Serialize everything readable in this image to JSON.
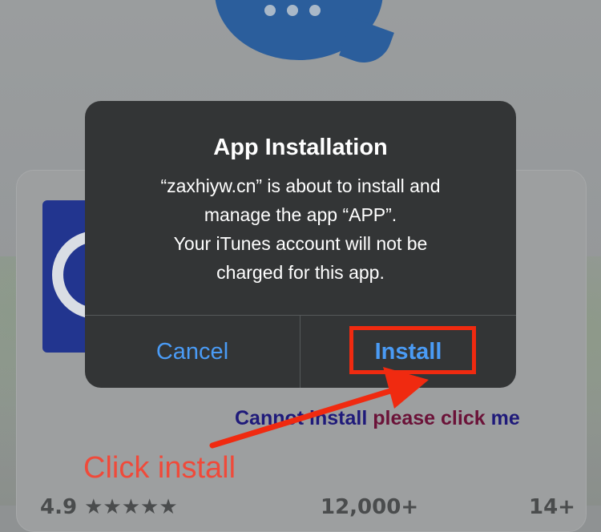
{
  "alert": {
    "title": "App Installation",
    "message_lines": [
      "“zaxhiyw.cn” is about to install and",
      "manage the app “APP”.",
      "Your iTunes account will not be",
      "charged for this app."
    ],
    "cancel_label": "Cancel",
    "install_label": "Install"
  },
  "page": {
    "link_text_part1": "Cannot install",
    "link_text_part2": "please click",
    "link_text_part3": "me",
    "rating_fragment": "4.9 ★★★★★",
    "count_fragment": "12,000+",
    "age_fragment": "14+"
  },
  "annotation": {
    "label": "Click install",
    "highlight_color": "#f02a10",
    "label_color": "#f04a3a"
  },
  "colors": {
    "alert_bg": "#333536",
    "button_blue": "#4a9bf5",
    "brand_blue": "#2b5e9c"
  }
}
